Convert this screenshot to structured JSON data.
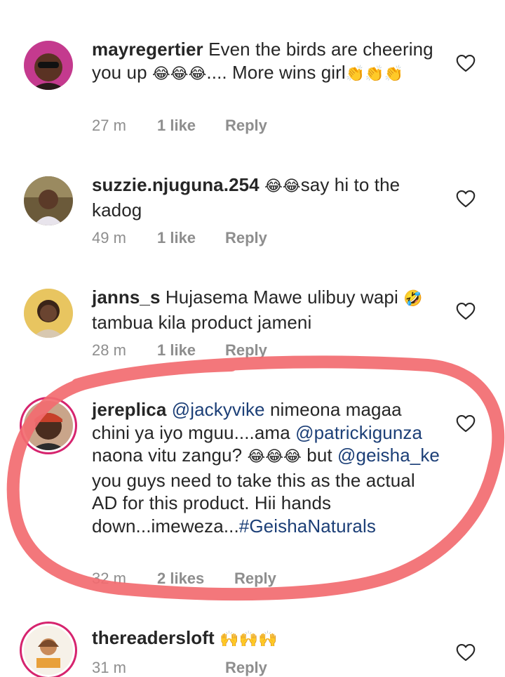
{
  "comments": [
    {
      "username": "mayregertier",
      "pre": "Even the birds are cheering you up ",
      "emoji1": "😂😂😂",
      "mid": ".... More wins girl",
      "emoji2": "👏👏👏",
      "time": "27 m",
      "likes": "1 like",
      "reply": "Reply"
    },
    {
      "username": "suzzie.njuguna.254",
      "emoji1": "😂😂",
      "text": "say hi to the kadog",
      "time": "49 m",
      "likes": "1 like",
      "reply": "Reply"
    },
    {
      "username": "janns_s",
      "text": "Hujasema Mawe ulibuy wapi",
      "emoji1": "🤣",
      "text2": " tambua kila product jameni",
      "time": "28 m",
      "likes": "1 like",
      "reply": "Reply"
    },
    {
      "username": "jereplica",
      "mention1": "@jackyvike",
      "text1": " nimeona magaa chini ya iyo mguu....ama ",
      "mention2": "@patrickigunza",
      "text2": " naona vitu zangu? ",
      "emoji1": "😂😂😂",
      "text3": " but ",
      "mention3": "@geisha_ke",
      "text4": " you guys need to take this as the actual AD for this product. Hii hands down...imeweza...",
      "hashtag": "#GeishaNaturals",
      "time": "32 m",
      "likes": "2 likes",
      "reply": "Reply"
    },
    {
      "username": "thereadersloft",
      "emoji1": "🙌🙌🙌",
      "time": "31 m",
      "likes": "",
      "reply": "Reply"
    }
  ],
  "icons": {
    "like": "heart-outline-icon"
  },
  "colors": {
    "mention": "#1c3f77",
    "meta": "#8e8e8e",
    "annotation": "#f26b70",
    "story_ring": "#d6246e"
  }
}
